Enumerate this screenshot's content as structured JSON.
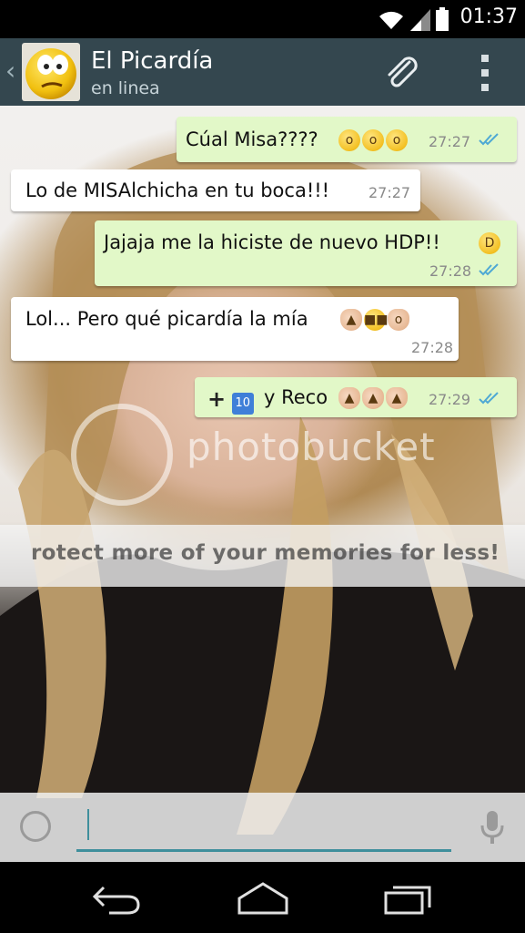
{
  "status_bar": {
    "time": "01:37",
    "icons": [
      "wifi-icon",
      "signal-icon",
      "battery-icon"
    ]
  },
  "header": {
    "contact_name": "El Picardía",
    "contact_status": "en linea",
    "actions": [
      "attach-icon",
      "overflow-menu-icon"
    ]
  },
  "wallpaper_watermark": {
    "brand": "photobucket",
    "tagline": "rotect more of your memories for less!"
  },
  "messages": [
    {
      "direction": "out",
      "text": "Cúal Misa????",
      "emojis": [
        "astonished-face-icon",
        "astonished-face-icon",
        "astonished-face-icon"
      ],
      "time": "27:27",
      "status": "read"
    },
    {
      "direction": "in",
      "text": "Lo de MISAlchicha en tu boca!!!",
      "time": "27:27"
    },
    {
      "direction": "out",
      "text": "Jajaja me la hiciste de nuevo HDP!!",
      "emojis": [
        "tears-of-joy-icon"
      ],
      "time": "27:28",
      "status": "read"
    },
    {
      "direction": "in",
      "text": "Lol... Pero qué picardía la mía",
      "emojis": [
        "thumbs-up-icon",
        "sunglasses-face-icon",
        "ok-hand-icon"
      ],
      "time": "27:28"
    },
    {
      "direction": "out",
      "prefix_emojis": [
        "heavy-plus-icon",
        "keycap-ten-icon"
      ],
      "text": "y Reco",
      "emojis": [
        "thumbs-up-icon",
        "thumbs-up-icon",
        "thumbs-up-icon"
      ],
      "time": "27:29",
      "status": "read"
    }
  ],
  "composer": {
    "placeholder": "",
    "left_icon": "emoji-icon",
    "right_icon": "microphone-icon"
  },
  "navigation": [
    "back-icon",
    "home-icon",
    "recents-icon"
  ],
  "colors": {
    "action_bar": "#34474f",
    "outgoing_bubble": "#e2f8c8",
    "incoming_bubble": "#ffffff",
    "read_ticks": "#4fa9d4",
    "input_underline": "#3f8f9c"
  }
}
